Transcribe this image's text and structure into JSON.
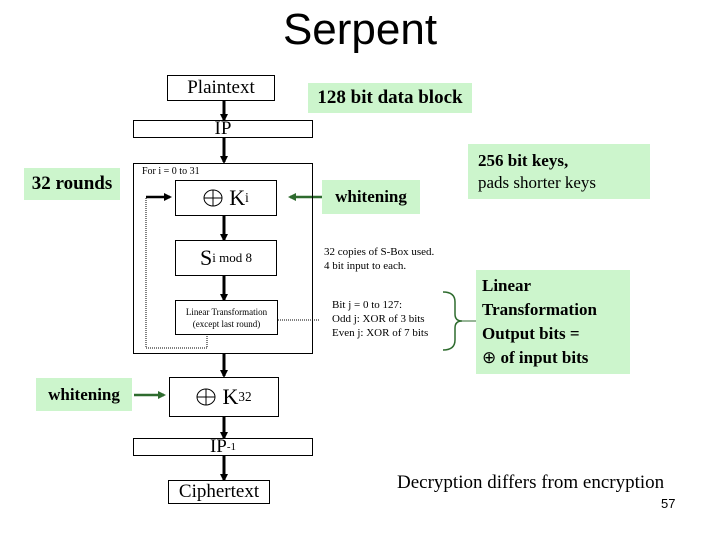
{
  "slide": {
    "title": "Serpent",
    "page_number": "57"
  },
  "flow": {
    "plaintext": "Plaintext",
    "ip": "IP",
    "loop_label": "For i = 0 to 31",
    "key_mix_symbol": "⊕",
    "key_mix_key": "K",
    "key_mix_sub": "i",
    "sbox_main": "S",
    "sbox_sub": "i mod 8",
    "linear_line1": "Linear Transformation",
    "linear_line2": "(except last round)",
    "final_key": "K",
    "final_key_sub": "32",
    "ip_inverse": "IP",
    "ip_inverse_sup": "-1",
    "ciphertext": "Ciphertext"
  },
  "annotations": {
    "data_block": "128 bit data block",
    "rounds": "32 rounds",
    "whitening_top": "whitening",
    "keys_line1": "256 bit keys,",
    "keys_line2": "pads shorter keys",
    "sbox_note_line1": "32 copies of S-Box used.",
    "sbox_note_line2": "4 bit input to each.",
    "lt_note_line1": "Bit j = 0 to 127:",
    "lt_note_line2": "Odd j: XOR of 3 bits",
    "lt_note_line3": "Even j: XOR of 7 bits",
    "lt_summary_line1": "Linear",
    "lt_summary_line2": "Transformation",
    "lt_summary_line3": "Output bits =",
    "lt_summary_line4_symbol": "⊕",
    "lt_summary_line4_text": " of input bits",
    "whitening_bottom": "whitening",
    "decryption_note": "Decryption differs from encryption"
  },
  "colors": {
    "highlight": "#ccf5cc",
    "arrow_green": "#2e6b2e"
  }
}
